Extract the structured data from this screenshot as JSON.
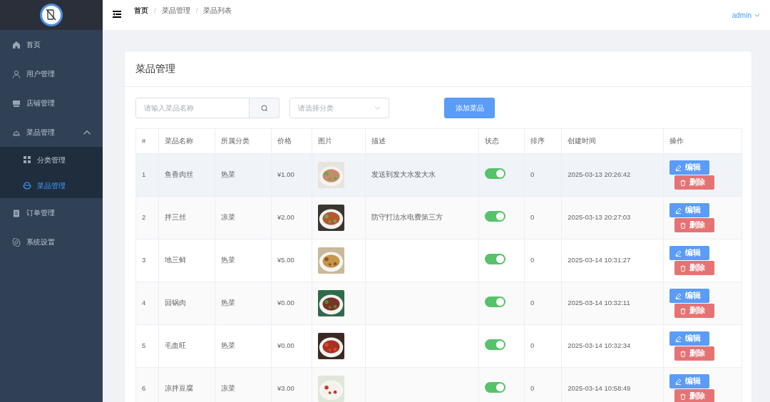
{
  "sidebar": {
    "items": [
      {
        "label": "首页",
        "selected": false
      },
      {
        "label": "用户管理",
        "selected": false
      },
      {
        "label": "店铺管理",
        "selected": false
      },
      {
        "label": "菜品管理",
        "selected": false,
        "expanded": true,
        "children": [
          {
            "label": "分类管理",
            "selected": false
          },
          {
            "label": "菜品管理",
            "selected": true
          }
        ]
      },
      {
        "label": "订单管理",
        "selected": false
      },
      {
        "label": "系统设置",
        "selected": false
      }
    ]
  },
  "breadcrumb": [
    {
      "label": "首页"
    },
    {
      "separator": "/",
      "label": "菜品管理"
    },
    {
      "separator": "/",
      "label": "菜品列表"
    }
  ],
  "user_menu": {
    "label": "admin"
  },
  "card": {
    "title": "菜品管理",
    "search": {
      "placeholder": "请输入菜品名称"
    },
    "category_select": {
      "placeholder": "请选择分类"
    },
    "add_button": "添加菜品",
    "table": {
      "columns": [
        "#",
        "菜品名称",
        "所属分类",
        "价格",
        "图片",
        "描述",
        "状态",
        "排序",
        "创建时间",
        "操作"
      ],
      "rows": [
        {
          "index": "1",
          "name": "鱼香肉丝",
          "category": "热菜",
          "price": "¥1.00",
          "description": "发送到发大水发大水",
          "on": true,
          "sort": "0",
          "created": "2025-03-13 20:26:42",
          "highlighted": true,
          "actions": [
            "编辑",
            "删除"
          ]
        },
        {
          "index": "2",
          "name": "拌三丝",
          "category": "凉菜",
          "price": "¥2.00",
          "description": "防守打法水电费第三方",
          "on": true,
          "sort": "0",
          "created": "2025-03-13 20:27:03",
          "highlighted": false,
          "actions": [
            "编辑",
            "删除"
          ]
        },
        {
          "index": "3",
          "name": "地三鲜",
          "category": "热菜",
          "price": "¥5.00",
          "on": true,
          "sort": "0",
          "created": "2025-03-14 10:31:27",
          "highlighted": false,
          "actions": [
            "编辑",
            "删除"
          ]
        },
        {
          "index": "4",
          "name": "回锅肉",
          "category": "热菜",
          "price": "¥0.00",
          "on": true,
          "sort": "0",
          "created": "2025-03-14 10:32:11",
          "highlighted": false,
          "actions": [
            "编辑",
            "删除"
          ]
        },
        {
          "index": "5",
          "name": "毛血旺",
          "category": "热菜",
          "price": "¥0.00",
          "on": true,
          "sort": "0",
          "created": "2025-03-14 10:32:34",
          "highlighted": false,
          "actions": [
            "编辑",
            "删除"
          ]
        },
        {
          "index": "6",
          "name": "凉拌豆腐",
          "category": "凉菜",
          "price": "¥3.00",
          "on": true,
          "sort": "0",
          "created": "2025-03-14 10:58:49",
          "highlighted": false,
          "actions": [
            "编辑",
            "删除"
          ]
        }
      ]
    }
  }
}
